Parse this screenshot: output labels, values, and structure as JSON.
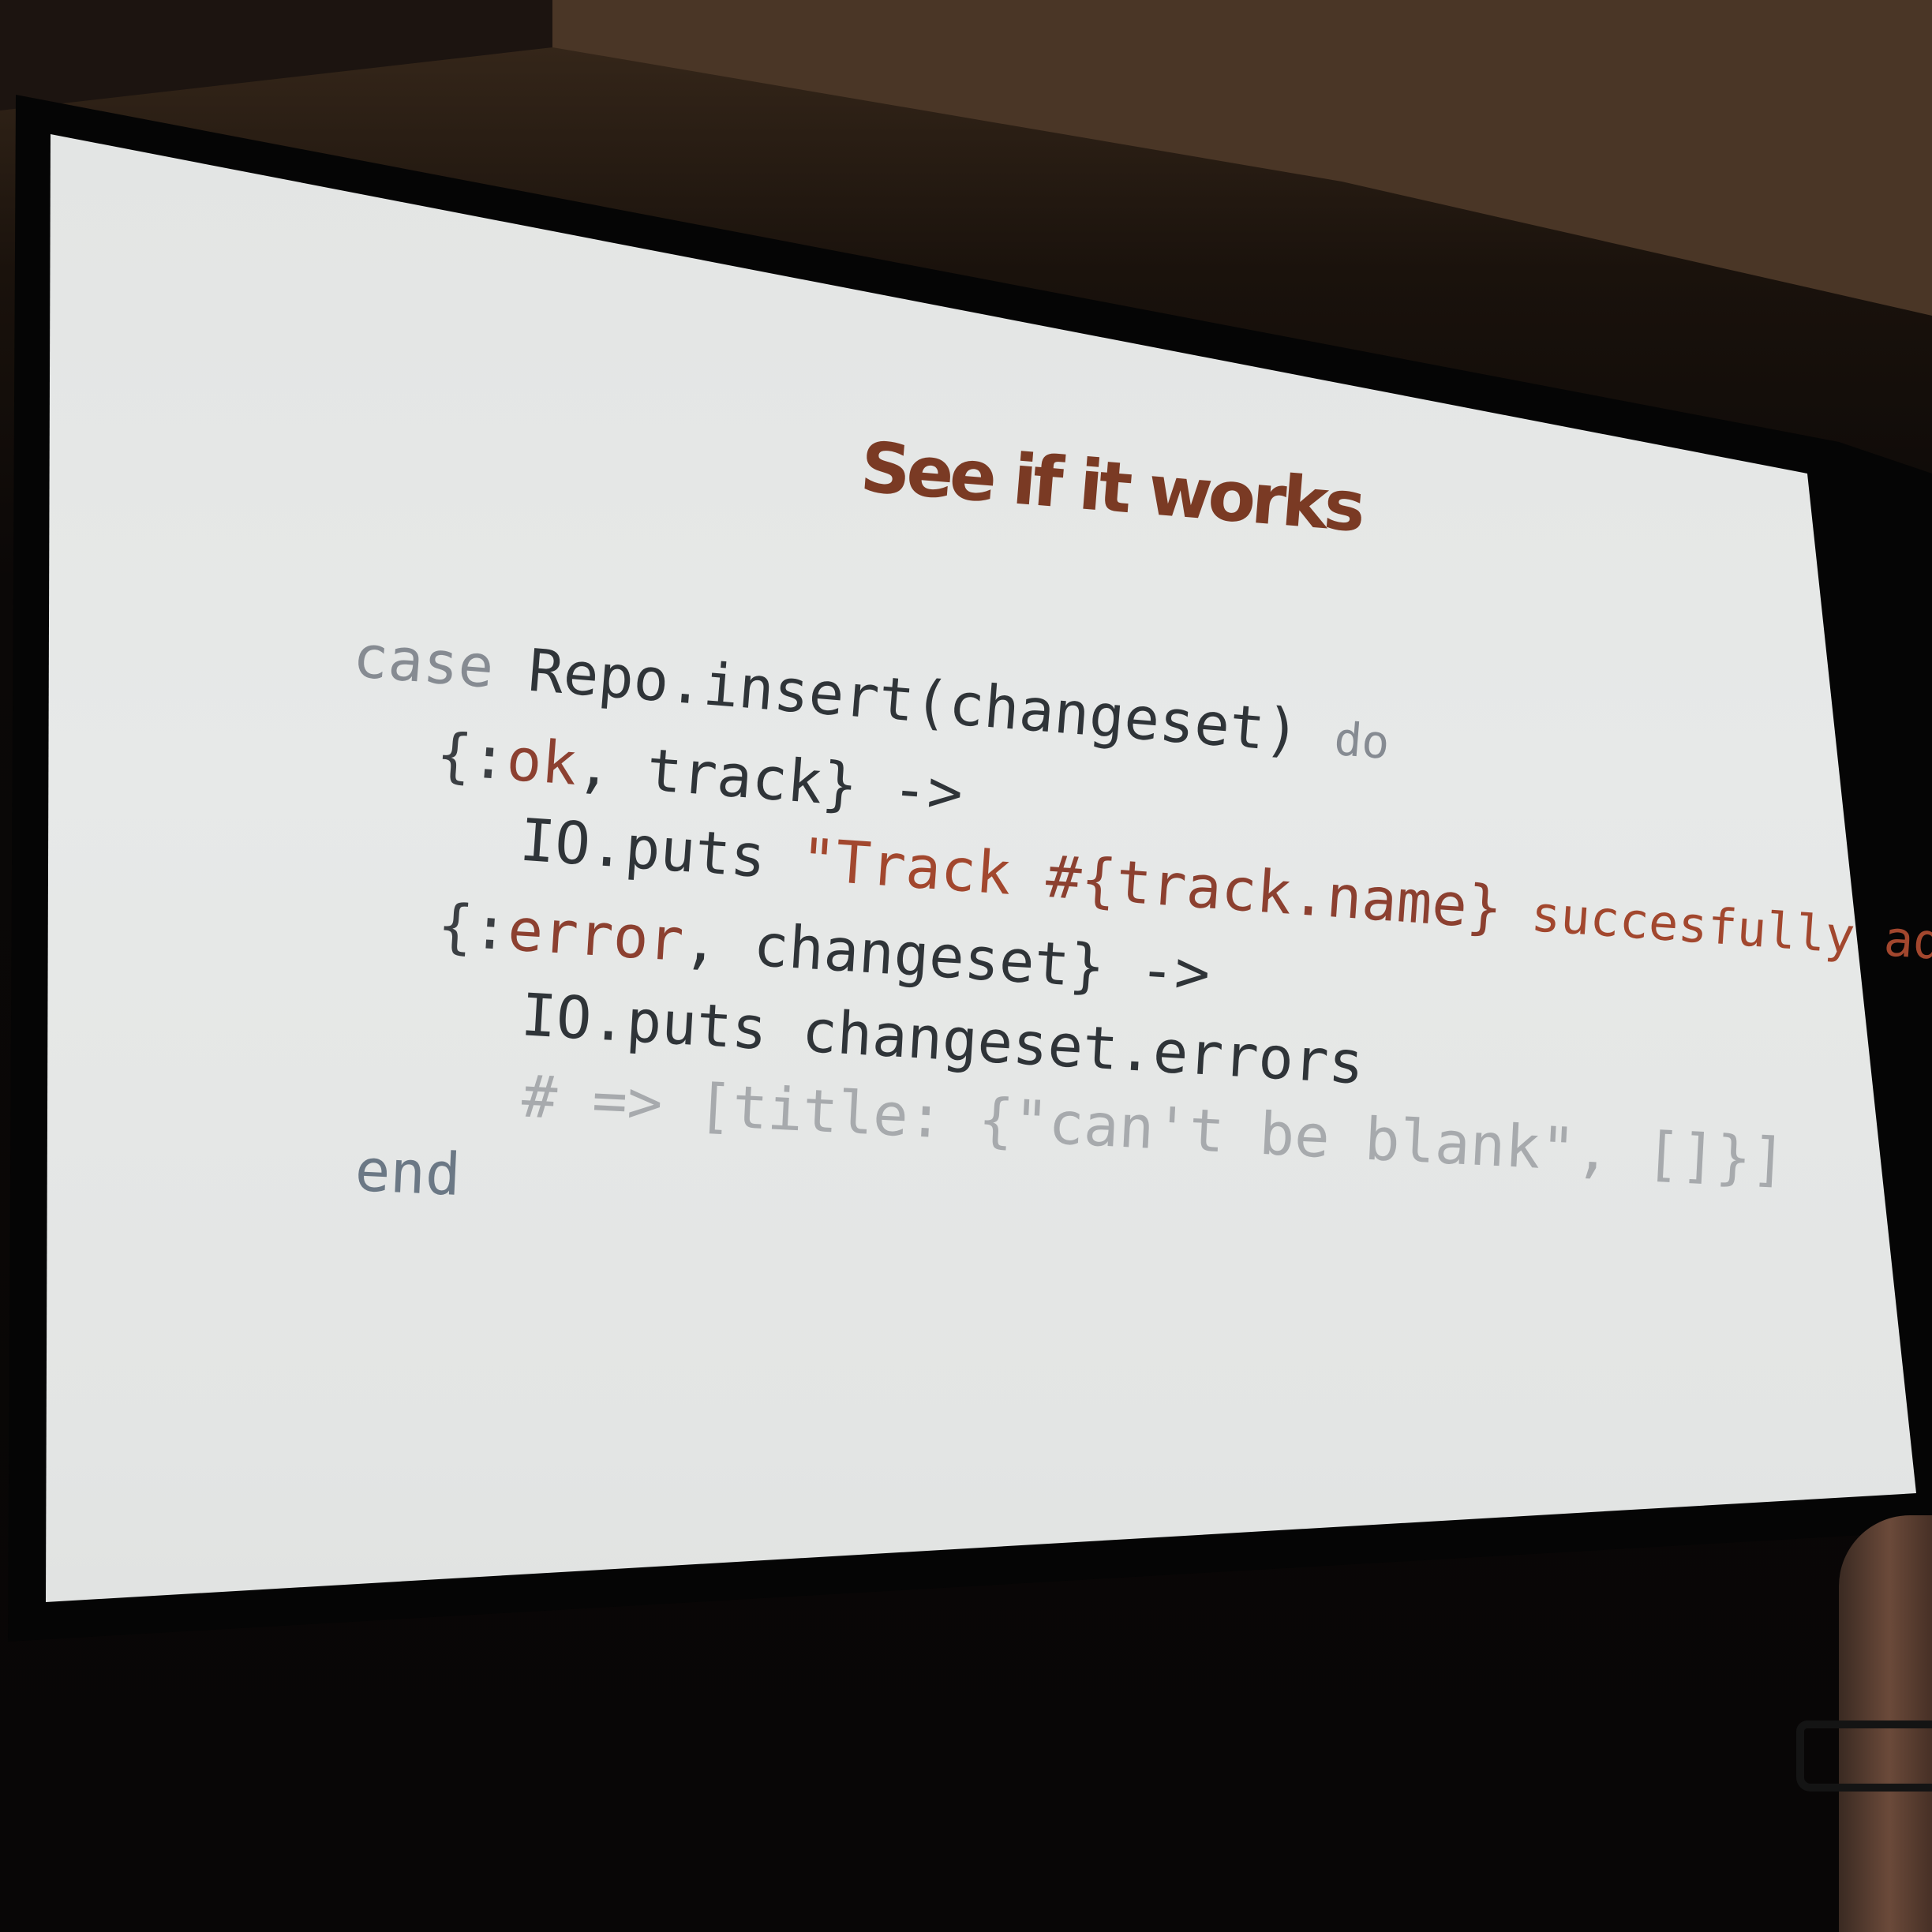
{
  "slide": {
    "title": "See if it works",
    "code": {
      "line1_kw": "case",
      "line1_rest": " Repo.insert(changeset) ",
      "line1_do": "do",
      "line2_open": "{:",
      "line2_atom": "ok",
      "line2_rest": ", track} ->",
      "line3_call": "IO.puts ",
      "line3_str1": "\"Track ",
      "line3_interp": "#{track.name}",
      "line3_str2": " succesfully added\"",
      "line4_open": "{:",
      "line4_atom": "error",
      "line4_rest": ", changeset} ->",
      "line5": "IO.puts changeset.errors",
      "line6_comment": "# => [title: {\"can't be blank\", []}]",
      "line7_end": "end"
    }
  }
}
